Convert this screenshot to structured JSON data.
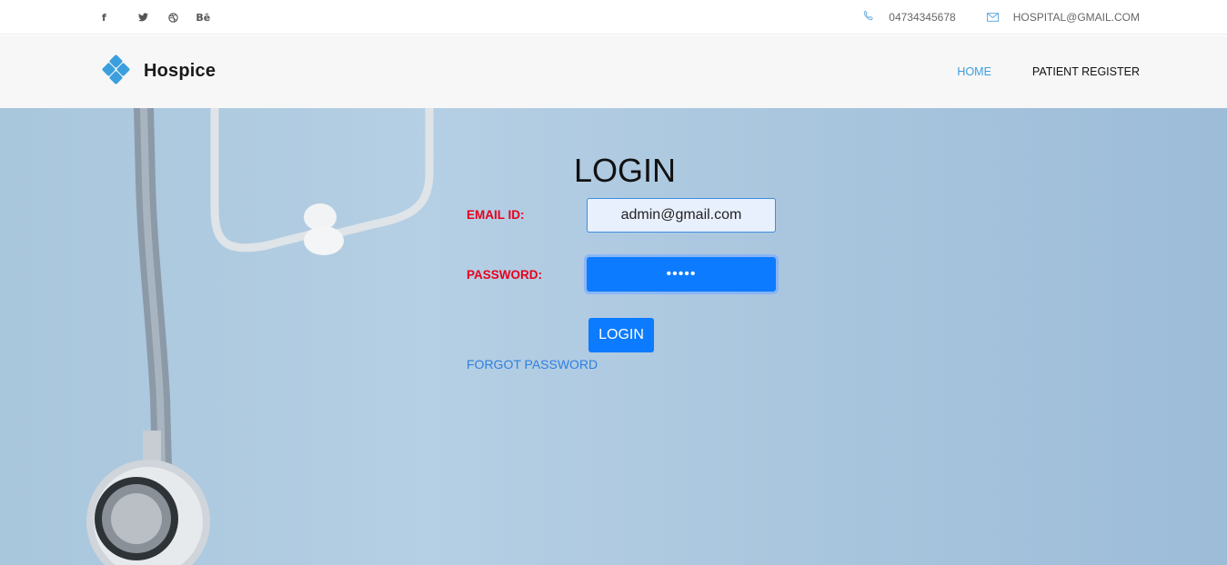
{
  "topbar": {
    "social": [
      {
        "icon": "facebook-icon",
        "glyph": "f"
      },
      {
        "icon": "twitter-icon",
        "glyph": "🐦"
      },
      {
        "icon": "dribbble-icon",
        "glyph": "◎"
      },
      {
        "icon": "behance-icon",
        "glyph": "Bē"
      }
    ],
    "phone": "04734345678",
    "email": "HOSPITAL@GMAIL.COM"
  },
  "nav": {
    "brand": "Hospice",
    "home": "HOME",
    "patient_register": "PATIENT REGISTER"
  },
  "login": {
    "title": "LOGIN",
    "email_label": "EMAIL ID:",
    "email_value": "admin@gmail.com",
    "password_label": "PASSWORD:",
    "password_value": "•••••",
    "button": "LOGIN",
    "forgot": "FORGOT PASSWORD"
  },
  "colors": {
    "accent": "#3b9fde",
    "primary_button": "#0d7bff",
    "label_red": "#e8001c"
  }
}
